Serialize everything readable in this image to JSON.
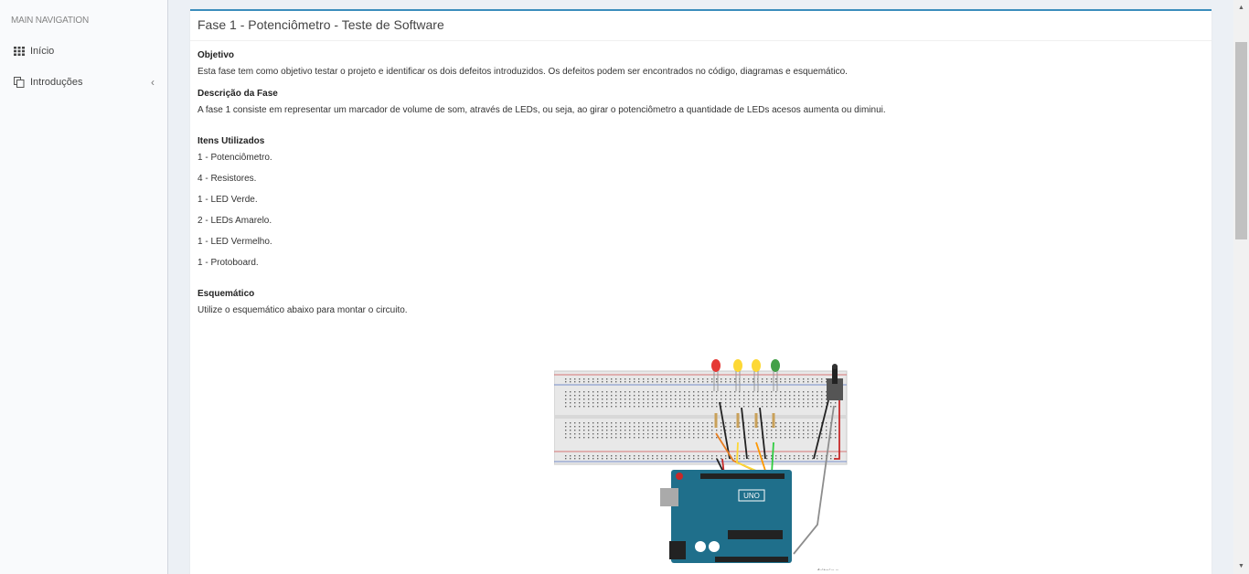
{
  "sidebar": {
    "header": "MAIN NAVIGATION",
    "items": [
      {
        "label": "Início",
        "icon": "grid-icon"
      },
      {
        "label": "Introduções",
        "icon": "copy-icon",
        "has_submenu": true
      }
    ]
  },
  "page": {
    "title": "Fase 1 - Potenciômetro - Teste de Software",
    "objective_heading": "Objetivo",
    "objective_text": "Esta fase tem como objetivo testar o projeto e identificar os dois defeitos introduzidos. Os defeitos podem ser encontrados no código, diagramas e esquemático.",
    "description_heading": "Descrição da Fase",
    "description_text": "A fase 1 consiste em representar um marcador de volume de som, através de LEDs, ou seja, ao girar o potenciômetro a quantidade de LEDs acesos aumenta ou diminui.",
    "items_heading": "Itens Utilizados",
    "items": [
      "1 - Potenciômetro.",
      "4 - Resistores.",
      "1 - LED Verde.",
      "2 - LEDs Amarelo.",
      "1 - LED Vermelho.",
      "1 - Protoboard."
    ],
    "schematic_heading": "Esquemático",
    "schematic_text": "Utilize o esquemático abaixo para montar o circuito.",
    "figure_watermark": "fritzing",
    "board_label": "UNO"
  },
  "colors": {
    "accent": "#3c8dbc",
    "board": "#1f6f8b",
    "led_red": "#e53935",
    "led_yellow": "#fdd835",
    "led_green": "#43a047"
  }
}
